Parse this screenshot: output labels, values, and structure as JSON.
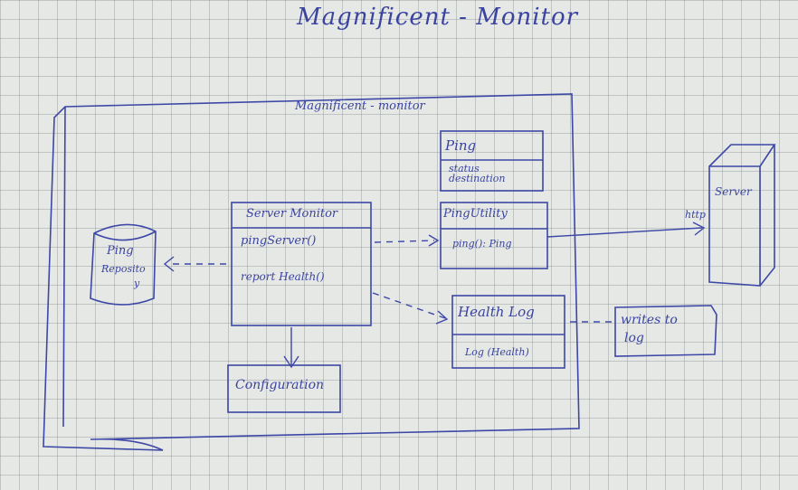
{
  "title": "Magnificent - Monitor",
  "frame_label": "Magnificent - monitor",
  "ping": {
    "name": "Ping",
    "field1": "status",
    "field2": "destination"
  },
  "ping_utility": {
    "name": "PingUtility",
    "method": "ping(): Ping"
  },
  "server_monitor": {
    "name": "Server Monitor",
    "method1": "pingServer()",
    "method2": "report Health()"
  },
  "ping_repository": {
    "line1": "Ping",
    "line2": "Reposito",
    "line3": "y"
  },
  "configuration": {
    "name": "Configuration"
  },
  "health_log": {
    "name": "Health Log",
    "method": "Log (Health)"
  },
  "writes_note": {
    "line1": "writes to",
    "line2": "log"
  },
  "server": {
    "name": "Server",
    "protocol": "http"
  }
}
